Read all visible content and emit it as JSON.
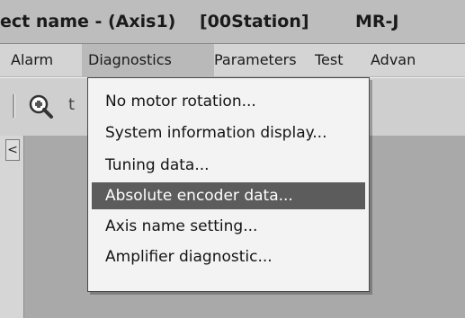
{
  "titlebar": {
    "seg1": "ect name - (Axis1)",
    "seg2": "[00Station]",
    "seg3": "MR-J"
  },
  "menubar": {
    "items": [
      "Alarm",
      "Diagnostics",
      "Parameters",
      "Test",
      "Advan"
    ]
  },
  "toolbar": {
    "partial_glyph": "t"
  },
  "leftpane": {
    "collapse_glyph": "<"
  },
  "diagnostics_menu": {
    "items": [
      "No motor rotation...",
      "System information display...",
      "Tuning data...",
      "Absolute encoder data...",
      "Axis name setting...",
      "Amplifier diagnostic..."
    ],
    "highlighted_index": 3
  },
  "colors": {
    "highlight": "#5c5c5c",
    "menu_bg": "#f3f3f3",
    "workspace": "#a9a9a9"
  }
}
